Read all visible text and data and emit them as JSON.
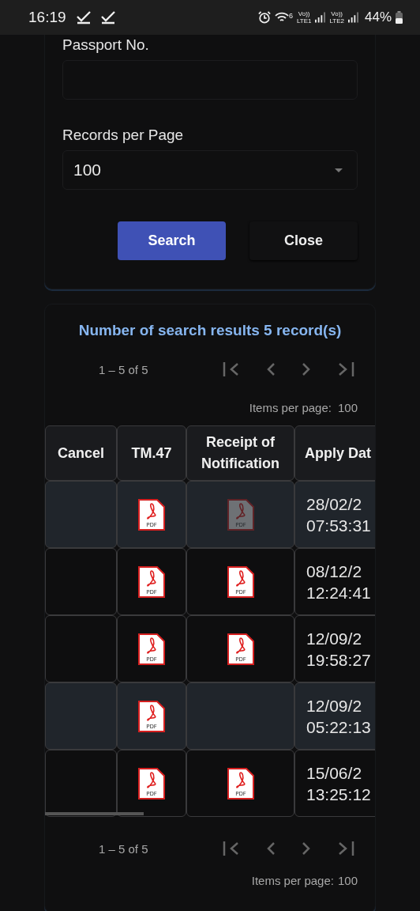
{
  "status_bar": {
    "time": "16:19",
    "wifi_label": "6",
    "sims": [
      {
        "top": "Vo))",
        "bottom": "LTE1"
      },
      {
        "top": "Vo))",
        "bottom": "LTE2"
      }
    ],
    "battery": "44%"
  },
  "search_form": {
    "passport": {
      "label": "Passport No."
    },
    "records_per_page": {
      "label": "Records per Page",
      "value": "100"
    },
    "buttons": [
      {
        "label": "Search",
        "kind": "primary"
      },
      {
        "label": "Close",
        "kind": "plain"
      }
    ]
  },
  "results": {
    "title": "Number of search results 5 record(s)",
    "paginator_top": {
      "range": "1 – 5 of 5",
      "items_label": "Items per page:",
      "items_value": "100"
    },
    "table": {
      "columns": [
        "Cancel",
        "TM.47",
        "Receipt of\nNotification",
        "Apply Dat"
      ],
      "rows": [
        {
          "striped": true,
          "tm47": {
            "label": "PDF",
            "disabled": false
          },
          "receipt": {
            "label": "PDF",
            "disabled": true
          },
          "apply_date": [
            "28/02/2",
            "07:53:31"
          ]
        },
        {
          "striped": false,
          "tm47": {
            "label": "PDF",
            "disabled": false
          },
          "receipt": {
            "label": "PDF",
            "disabled": false
          },
          "apply_date": [
            "08/12/2",
            "12:24:41"
          ]
        },
        {
          "striped": false,
          "tm47": {
            "label": "PDF",
            "disabled": false
          },
          "receipt": {
            "label": "PDF",
            "disabled": false
          },
          "apply_date": [
            "12/09/2",
            "19:58:27"
          ]
        },
        {
          "striped": true,
          "tm47": {
            "label": "PDF",
            "disabled": false
          },
          "apply_date": [
            "12/09/2",
            "05:22:13"
          ]
        },
        {
          "striped": false,
          "tm47": {
            "label": "PDF",
            "disabled": false
          },
          "receipt": {
            "label": "PDF",
            "disabled": false
          },
          "apply_date": [
            "15/06/2",
            "13:25:12"
          ]
        }
      ]
    },
    "paginator_bottom": {
      "range": "1 – 5 of 5",
      "items_label": "Items per page:",
      "items_value": "100"
    }
  }
}
